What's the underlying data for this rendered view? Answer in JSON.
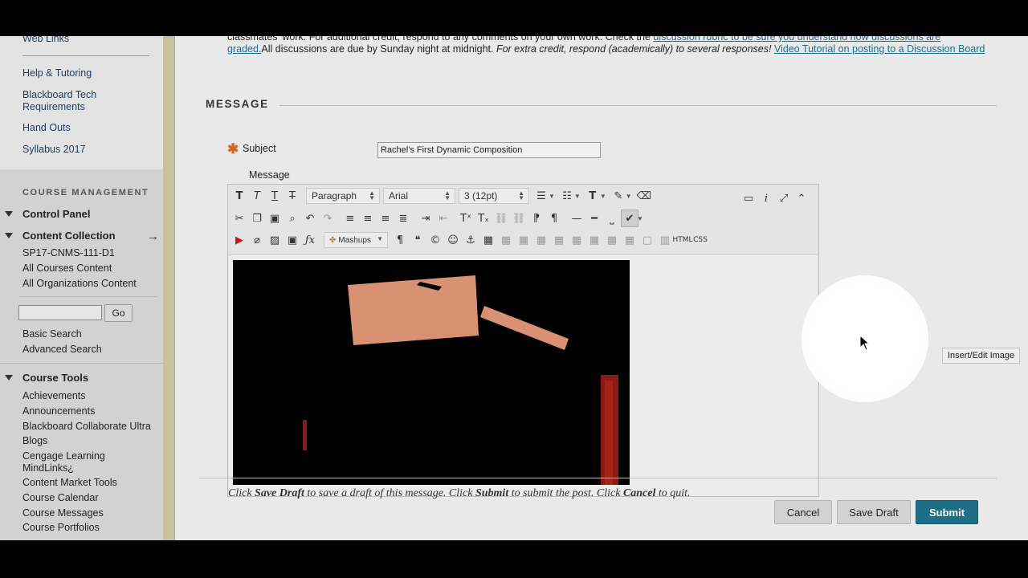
{
  "sidebar": {
    "top_links": [
      "Web Links",
      "Help & Tutoring",
      "Blackboard Tech Requirements",
      "Hand Outs",
      "Syllabus 2017"
    ],
    "management_title": "COURSE MANAGEMENT",
    "control_panel": "Control Panel",
    "content_collection": "Content Collection",
    "collection_links": [
      "SP17-CNMS-111-D1",
      "All Courses Content",
      "All Organizations Content"
    ],
    "search_placeholder": "",
    "go_label": "Go",
    "search_links": [
      "Basic Search",
      "Advanced Search"
    ],
    "course_tools": "Course Tools",
    "tool_links": [
      "Achievements",
      "Announcements",
      "Blackboard Collaborate Ultra",
      "Blogs",
      "Cengage Learning MindLinks¿",
      "Content Market Tools",
      "Course Calendar",
      "Course Messages",
      "Course Portfolios"
    ]
  },
  "instructions": {
    "line1_text": "classmates' work. For additional credit, respond to any comments on your own work. Check the ",
    "rubric_link": "discussion rubric to be sure you understand how discussions are graded.",
    "line2_text": "All discussions are due by Sunday night at midnight. ",
    "italic_text": "For extra credit, respond (academically) to several responses!",
    "video_link": "Video Tutorial on posting to a Discussion Board"
  },
  "message": {
    "heading": "MESSAGE",
    "subject_label": "Subject",
    "subject_value": "Rachel's First Dynamic Composition",
    "message_label": "Message"
  },
  "toolbar": {
    "format_select": "Paragraph",
    "font_select": "Arial",
    "size_select": "3 (12pt)",
    "mashups_label": "Mashups",
    "html_label": "HTML",
    "css_label": "CSS"
  },
  "tooltip": "Insert/Edit Image",
  "footer": {
    "p1": "Click ",
    "save_draft_word": "Save Draft",
    "p2": " to save a draft of this message. Click ",
    "submit_word": "Submit",
    "p3": " to submit the post. Click ",
    "cancel_word": "Cancel",
    "p4": " to quit."
  },
  "buttons": {
    "cancel": "Cancel",
    "save_draft": "Save Draft",
    "submit": "Submit"
  },
  "colors": {
    "accent": "#1e6e87",
    "required": "#d6661f",
    "link": "#1e6e8a"
  }
}
